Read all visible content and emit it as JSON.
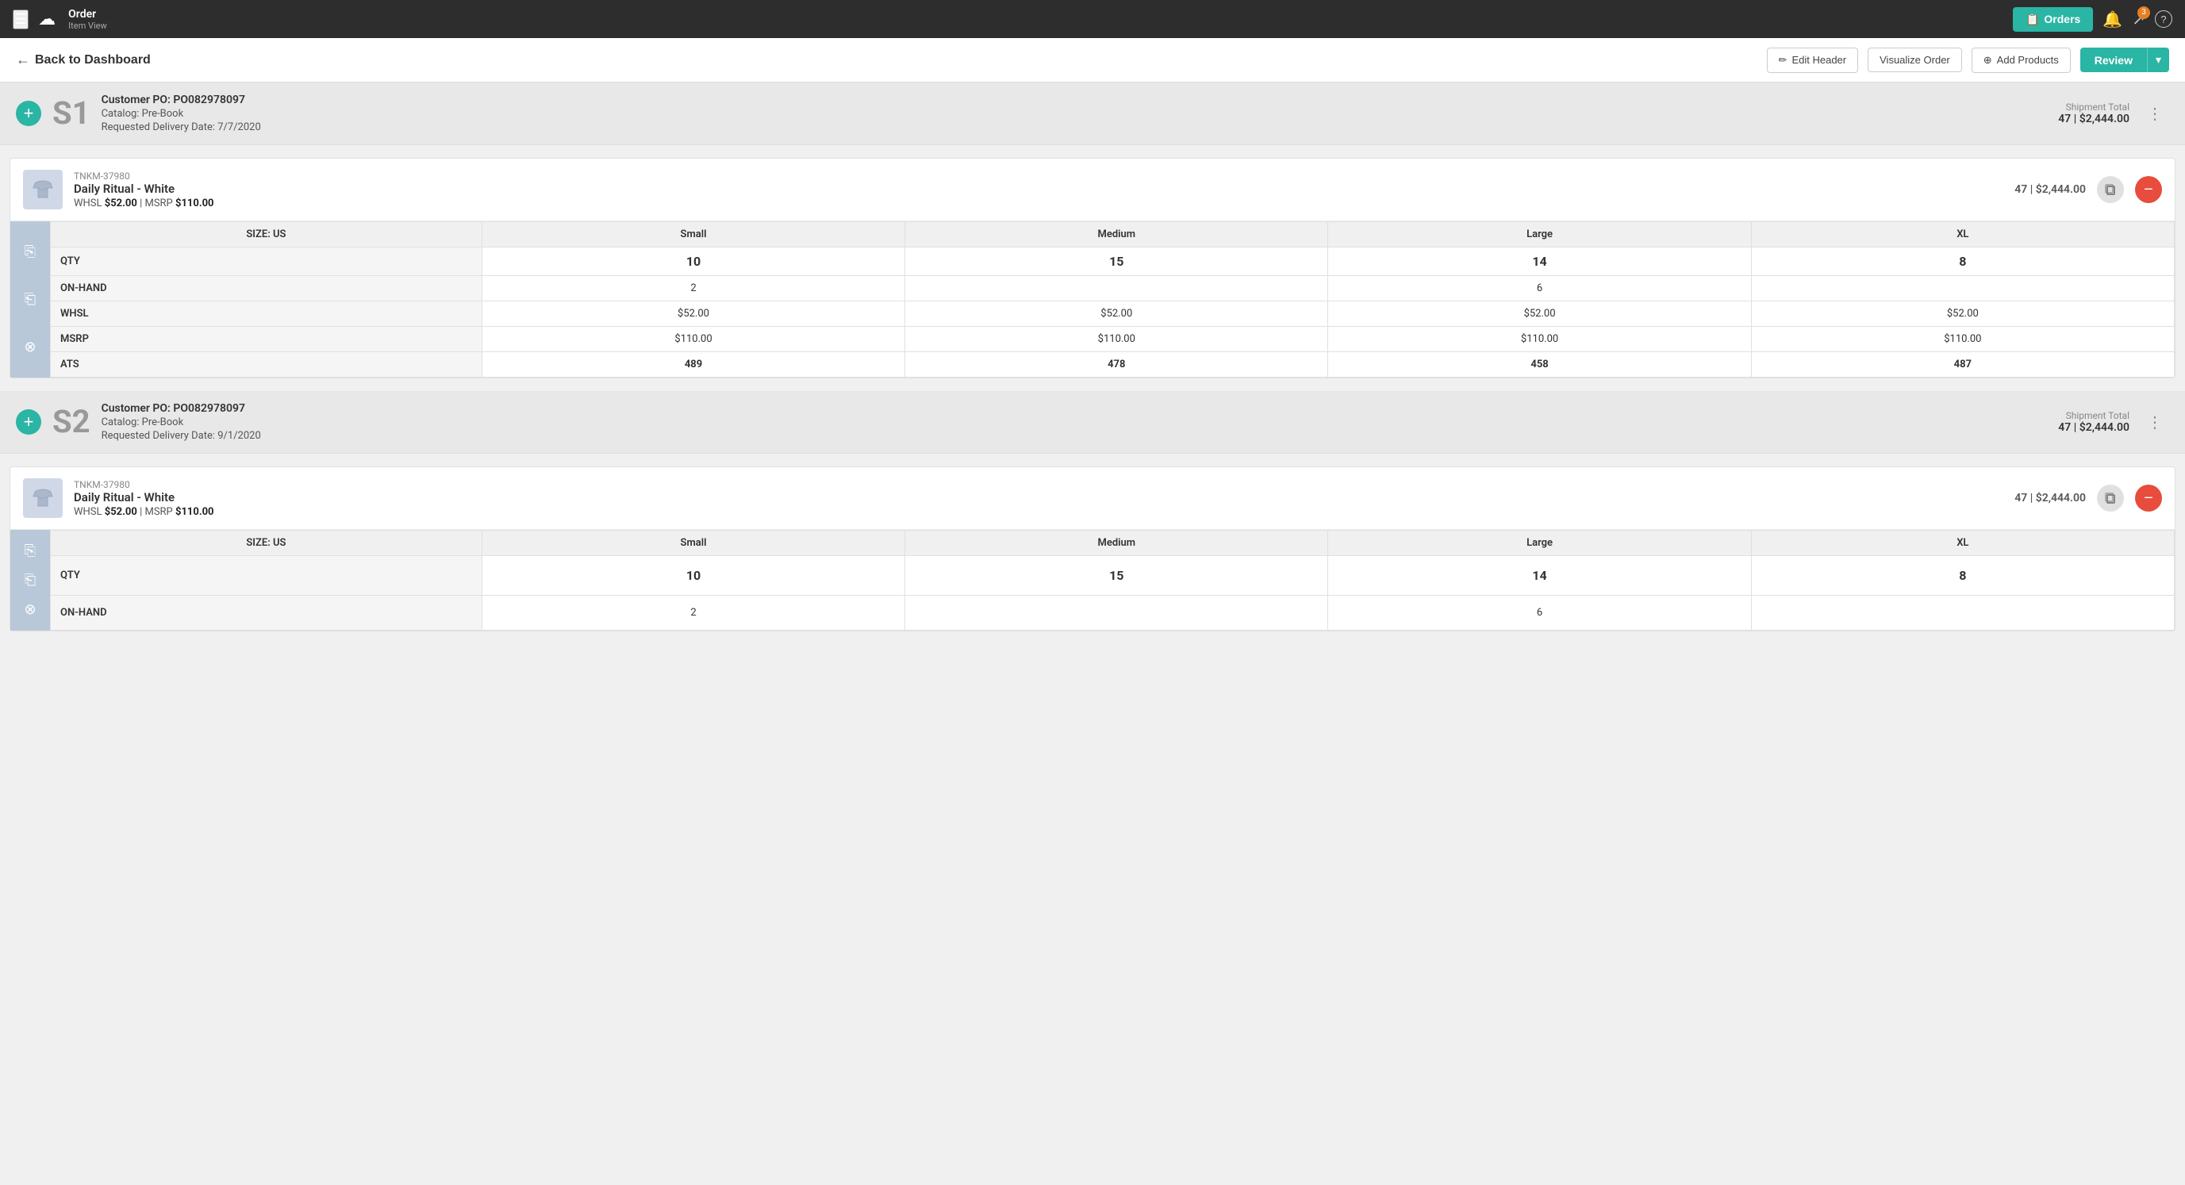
{
  "topNav": {
    "hamburger_icon": "☰",
    "logo": "☁",
    "title": "Order",
    "subtitle": "Item View",
    "orders_button": "Orders",
    "orders_icon": "📋",
    "notification_icon": "🔔",
    "share_icon": "↗",
    "share_badge": "3",
    "help_icon": "?"
  },
  "subHeader": {
    "back_label": "Back to Dashboard",
    "back_arrow": "←",
    "edit_header_label": "Edit Header",
    "edit_icon": "✏",
    "visualize_label": "Visualize Order",
    "add_products_label": "Add Products",
    "add_icon": "⊕",
    "review_label": "Review",
    "review_dropdown": "▾"
  },
  "shipments": [
    {
      "id": "s1",
      "code": "S1",
      "customer_po": "Customer PO: PO082978097",
      "catalog": "Catalog: Pre-Book",
      "delivery": "Requested Delivery Date: 7/7/2020",
      "total_label": "Shipment Total",
      "total_value": "47 | $2,444.00",
      "products": [
        {
          "sku": "TNKM-37980",
          "name": "Daily Ritual - White",
          "whsl_label": "WHSL",
          "whsl_price": "$52.00",
          "msrp_label": "MSRP",
          "msrp_price": "$110.00",
          "qty_total": "47 | $2,444.00",
          "sizes": {
            "header": [
              "SIZE: US",
              "Small",
              "Medium",
              "Large",
              "XL"
            ],
            "rows": [
              {
                "label": "QTY",
                "values": [
                  "10",
                  "15",
                  "14",
                  "8"
                ],
                "bold": true
              },
              {
                "label": "ON-HAND",
                "values": [
                  "2",
                  "",
                  "6",
                  ""
                ],
                "bold": false
              },
              {
                "label": "WHSL",
                "values": [
                  "$52.00",
                  "$52.00",
                  "$52.00",
                  "$52.00"
                ],
                "bold": false
              },
              {
                "label": "MSRP",
                "values": [
                  "$110.00",
                  "$110.00",
                  "$110.00",
                  "$110.00"
                ],
                "bold": false
              },
              {
                "label": "ATS",
                "values": [
                  "489",
                  "478",
                  "458",
                  "487"
                ],
                "bold": true
              }
            ]
          }
        }
      ]
    },
    {
      "id": "s2",
      "code": "S2",
      "customer_po": "Customer PO: PO082978097",
      "catalog": "Catalog: Pre-Book",
      "delivery": "Requested Delivery Date: 9/1/2020",
      "total_label": "Shipment Total",
      "total_value": "47 | $2,444.00",
      "products": [
        {
          "sku": "TNKM-37980",
          "name": "Daily Ritual - White",
          "whsl_label": "WHSL",
          "whsl_price": "$52.00",
          "msrp_label": "MSRP",
          "msrp_price": "$110.00",
          "qty_total": "47 | $2,444.00",
          "sizes": {
            "header": [
              "SIZE: US",
              "Small",
              "Medium",
              "Large",
              "XL"
            ],
            "rows": [
              {
                "label": "QTY",
                "values": [
                  "10",
                  "15",
                  "14",
                  "8"
                ],
                "bold": true
              },
              {
                "label": "ON-HAND",
                "values": [
                  "2",
                  "",
                  "6",
                  ""
                ],
                "bold": false
              }
            ]
          }
        }
      ]
    }
  ]
}
